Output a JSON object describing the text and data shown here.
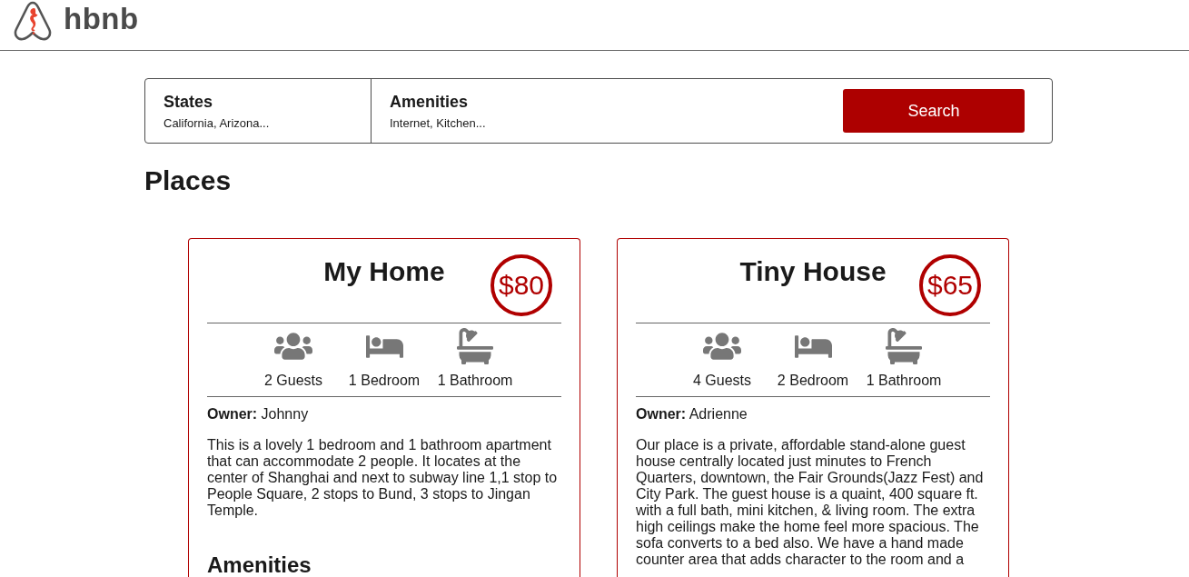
{
  "header": {
    "logo_text": "hbnb"
  },
  "filters": [
    {
      "title": "States",
      "summary": "California, Arizona..."
    },
    {
      "title": "Amenities",
      "summary": "Internet, Kitchen..."
    }
  ],
  "search_button": "Search",
  "places": {
    "title": "Places",
    "items": [
      {
        "name": "My Home",
        "price": "$80",
        "info": [
          {
            "kind": "guests",
            "label": "2 Guests"
          },
          {
            "kind": "bedrooms",
            "label": "1 Bedroom"
          },
          {
            "kind": "bathrooms",
            "label": "1 Bathroom"
          }
        ],
        "owner": "**Owner:** Johnny",
        "description": "This is a lovely 1 bedroom and 1 bathroom apartment that can accommodate 2 people. It locates at the center of Shanghai and next to subway line 1,1 stop to People Square, 2 stops to Bund, 3 stops to Jingan Temple.",
        "amenities_title": "Amenities"
      },
      {
        "name": "Tiny House",
        "price": "$65",
        "info": [
          {
            "kind": "guests",
            "label": "4 Guests"
          },
          {
            "kind": "bedrooms",
            "label": "2 Bedroom"
          },
          {
            "kind": "bathrooms",
            "label": "1 Bathroom"
          }
        ],
        "owner": "**Owner:** Adrienne",
        "description": "Our place is a private, affordable stand-alone guest house centrally located just minutes to French Quarters, downtown, the Fair Grounds(Jazz Fest) and City Park. The guest house is a quaint, 400 square ft. with a full bath, mini kitchen, & living room. The extra high ceilings make the home feel more spacious. The sofa converts to a bed also. We have a hand made counter area that adds character to the room and a"
      }
    ]
  }
}
